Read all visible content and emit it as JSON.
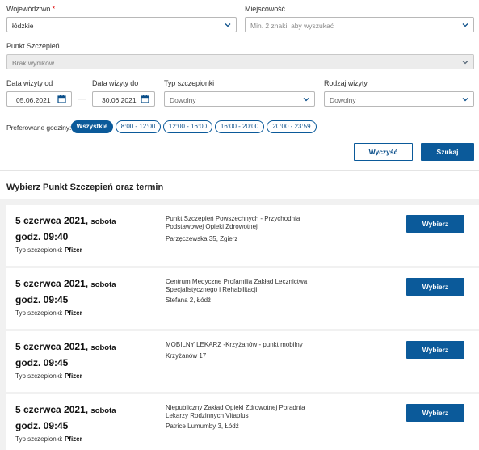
{
  "filters": {
    "voivodeship": {
      "label": "Województwo",
      "required_mark": "*",
      "value": "łódzkie"
    },
    "city": {
      "label": "Miejscowość",
      "placeholder": "Min. 2 znaki, aby wyszukać"
    },
    "point": {
      "label": "Punkt Szczepień",
      "value": "Brak wyników"
    },
    "date_from": {
      "label": "Data wizyty od",
      "value": "05.06.2021"
    },
    "date_to": {
      "label": "Data wizyty do",
      "value": "30.06.2021"
    },
    "date_separator": "—",
    "vaccine_type": {
      "label": "Typ szczepionki",
      "value": "Dowolny"
    },
    "visit_kind": {
      "label": "Rodzaj wizyty",
      "value": "Dowolny"
    },
    "hours": {
      "label": "Preferowane godziny:",
      "options": [
        "Wszystkie",
        "8:00 - 12:00",
        "12:00 - 16:00",
        "16:00 - 20:00",
        "20:00 - 23:59"
      ],
      "selected": "Wszystkie"
    },
    "clear_button": "Wyczyść",
    "search_button": "Szukaj"
  },
  "results": {
    "title": "Wybierz Punkt Szczepień oraz termin",
    "vaccine_label": "Typ szczepionki:",
    "choose_label": "Wybierz",
    "items": [
      {
        "date": "5 czerwca 2021,",
        "dow": "sobota",
        "time": "godz. 09:40",
        "vaccine": "Pfizer",
        "place": "Punkt Szczepień Powszechnych - Przychodnia Podstawowej Opieki Zdrowotnej",
        "address": "Parzęczewska 35, Zgierz"
      },
      {
        "date": "5 czerwca 2021,",
        "dow": "sobota",
        "time": "godz. 09:45",
        "vaccine": "Pfizer",
        "place": "Centrum Medyczne Profamilia Zakład Lecznictwa Specjalistycznego i Rehabilitacji",
        "address": "Stefana 2, Łódź"
      },
      {
        "date": "5 czerwca 2021,",
        "dow": "sobota",
        "time": "godz. 09:45",
        "vaccine": "Pfizer",
        "place": "MOBILNY LEKARZ -Krzyżanów - punkt mobilny",
        "address": "Krzyżanów 17"
      },
      {
        "date": "5 czerwca 2021,",
        "dow": "sobota",
        "time": "godz. 09:45",
        "vaccine": "Pfizer",
        "place": "Niepubliczny Zakład Opieki Zdrowotnej Poradnia Lekarzy Rodzinnych Vitaplus",
        "address": "Patrice Lumumby 3, Łódź"
      }
    ]
  },
  "icons": {
    "chevron": "chevron-down-icon",
    "calendar": "calendar-icon"
  },
  "colors": {
    "primary": "#0b5a9a",
    "disabled_bg": "#ececec",
    "results_bg": "#f1f1f1"
  }
}
